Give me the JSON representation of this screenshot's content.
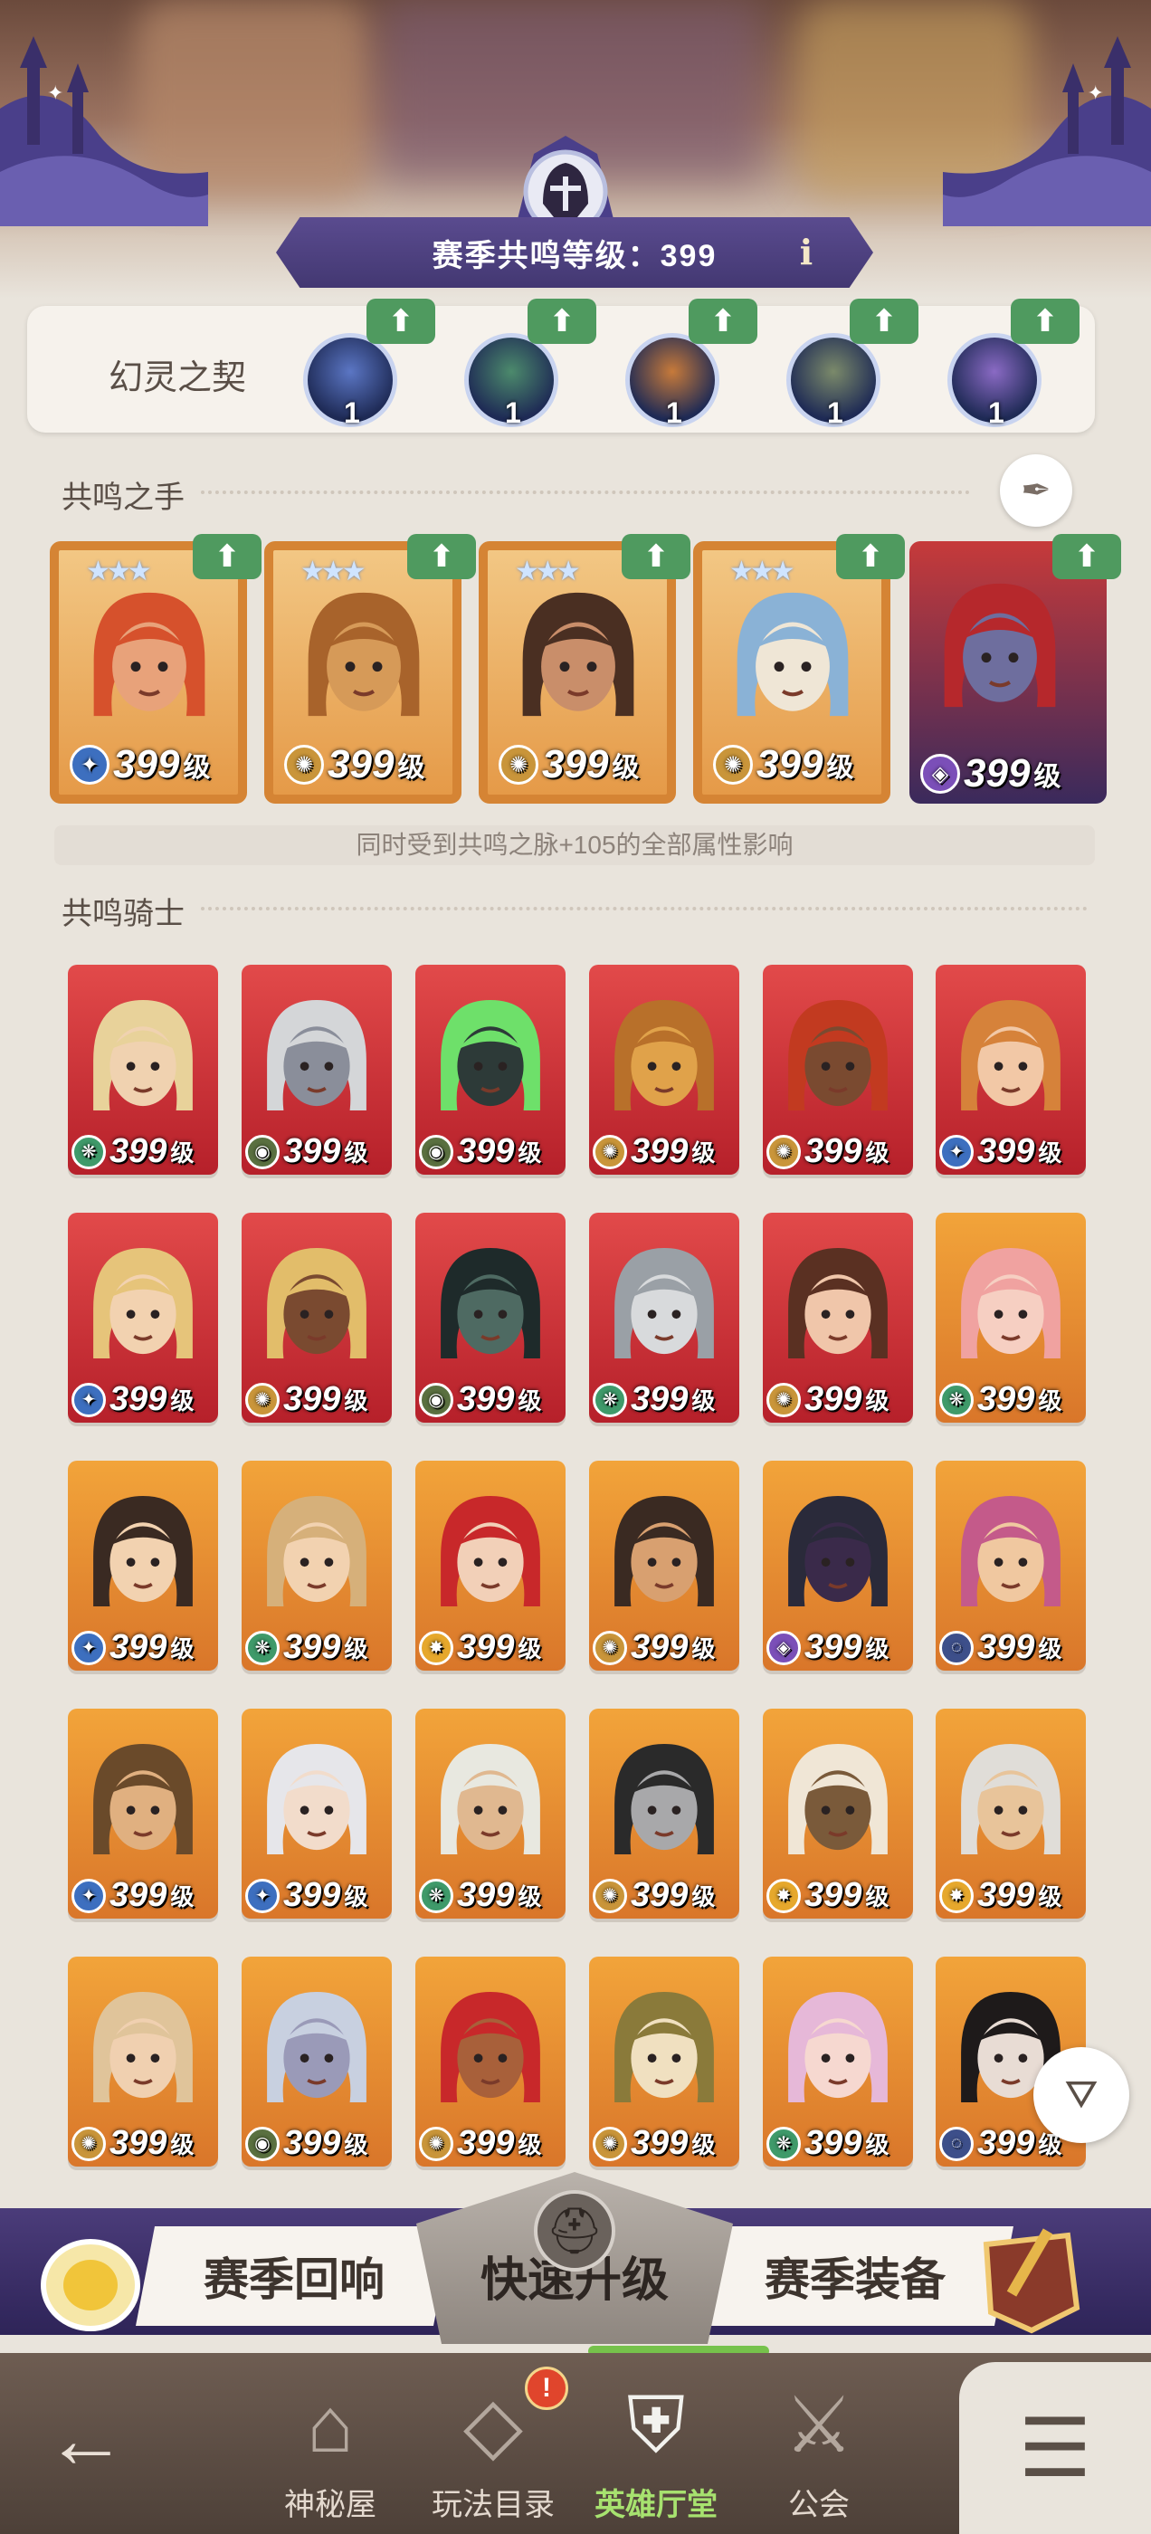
{
  "season": {
    "resonance_label": "赛季共鸣等级：399",
    "info_icon": "i"
  },
  "contract": {
    "title": "幻灵之契",
    "spirits": [
      {
        "level": "1",
        "element": "celestial",
        "color": "#5b76c4"
      },
      {
        "level": "1",
        "element": "forest",
        "color": "#4c8a6c"
      },
      {
        "level": "1",
        "element": "graveborn",
        "color": "#c77a3a"
      },
      {
        "level": "1",
        "element": "mauler",
        "color": "#7b8a6a"
      },
      {
        "level": "1",
        "element": "hypogean",
        "color": "#8a6ac4"
      }
    ],
    "up_icon": "⬆"
  },
  "hand": {
    "title": "共鸣之手",
    "quill_icon": "✒",
    "cards": [
      {
        "level": "399",
        "unit": "级",
        "element_icon": "✦",
        "element_color": "#3d6fbf",
        "stars": "★★★",
        "face": "#e8a27a",
        "hair": "#d6512c"
      },
      {
        "level": "399",
        "unit": "级",
        "element_icon": "✺",
        "element_color": "#c9953a",
        "stars": "★★★",
        "face": "#d69a58",
        "hair": "#a8632b"
      },
      {
        "level": "399",
        "unit": "级",
        "element_icon": "✺",
        "element_color": "#c9953a",
        "stars": "★★★",
        "face": "#c98e6a",
        "hair": "#4a2f22"
      },
      {
        "level": "399",
        "unit": "级",
        "element_icon": "✺",
        "element_color": "#c9953a",
        "stars": "★★★",
        "face": "#efe6d6",
        "hair": "#8ab2d6"
      },
      {
        "level": "399",
        "unit": "级",
        "element_icon": "◈",
        "element_color": "#7b4fb8",
        "stars": "",
        "face": "#6e6e9e",
        "hair": "#b6282c"
      }
    ],
    "note": "同时受到共鸣之脉+105的全部属性影响"
  },
  "knights": {
    "title": "共鸣骑士",
    "rows": [
      [
        {
          "level": "399",
          "unit": "级",
          "bg": "red",
          "element_icon": "❋",
          "element_color": "#3f9a6a",
          "face": "#f0d2b0",
          "hair": "#e8d29a"
        },
        {
          "level": "399",
          "unit": "级",
          "bg": "red",
          "element_icon": "◉",
          "element_color": "#5a7040",
          "face": "#8a8e9a",
          "hair": "#d4d6d8"
        },
        {
          "level": "399",
          "unit": "级",
          "bg": "red",
          "element_icon": "◉",
          "element_color": "#5a7040",
          "face": "#2d3a38",
          "hair": "#6ee06a"
        },
        {
          "level": "399",
          "unit": "级",
          "bg": "red",
          "element_icon": "✺",
          "element_color": "#c9953a",
          "face": "#e0a24a",
          "hair": "#b8702a"
        },
        {
          "level": "399",
          "unit": "级",
          "bg": "red",
          "element_icon": "✺",
          "element_color": "#c9953a",
          "face": "#7a4a30",
          "hair": "#c23a20"
        },
        {
          "level": "399",
          "unit": "级",
          "bg": "red",
          "element_icon": "✦",
          "element_color": "#3d6fbf",
          "face": "#f2c8a6",
          "hair": "#d6823a"
        }
      ],
      [
        {
          "level": "399",
          "unit": "级",
          "bg": "red",
          "element_icon": "✦",
          "element_color": "#3d6fbf",
          "face": "#f2d2b0",
          "hair": "#e6c47a"
        },
        {
          "level": "399",
          "unit": "级",
          "bg": "red",
          "element_icon": "✺",
          "element_color": "#c9953a",
          "face": "#7a4a30",
          "hair": "#e2bd6a"
        },
        {
          "level": "399",
          "unit": "级",
          "bg": "red",
          "element_icon": "◉",
          "element_color": "#5a7040",
          "face": "#4e6a62",
          "hair": "#1e2a2a"
        },
        {
          "level": "399",
          "unit": "级",
          "bg": "red",
          "element_icon": "❋",
          "element_color": "#3f9a6a",
          "face": "#d8dadc",
          "hair": "#9aa0a6"
        },
        {
          "level": "399",
          "unit": "级",
          "bg": "red",
          "element_icon": "✺",
          "element_color": "#c9953a",
          "face": "#f0c6aa",
          "hair": "#5a3022"
        },
        {
          "level": "399",
          "unit": "级",
          "bg": "orange",
          "element_icon": "❋",
          "element_color": "#3f9a6a",
          "face": "#f6cfc2",
          "hair": "#f0a2a0"
        }
      ],
      [
        {
          "level": "399",
          "unit": "级",
          "bg": "orange",
          "element_icon": "✦",
          "element_color": "#3d6fbf",
          "face": "#f2d2b0",
          "hair": "#3a2a22"
        },
        {
          "level": "399",
          "unit": "级",
          "bg": "orange",
          "element_icon": "❋",
          "element_color": "#3f9a6a",
          "face": "#f2d2b0",
          "hair": "#d6b07a"
        },
        {
          "level": "399",
          "unit": "级",
          "bg": "orange",
          "element_icon": "✸",
          "element_color": "#e6a82c",
          "face": "#f2d0b8",
          "hair": "#c8282a"
        },
        {
          "level": "399",
          "unit": "级",
          "bg": "orange",
          "element_icon": "✺",
          "element_color": "#c9953a",
          "face": "#d8a070",
          "hair": "#3a2a22"
        },
        {
          "level": "399",
          "unit": "级",
          "bg": "orange",
          "element_icon": "◈",
          "element_color": "#7b4fb8",
          "face": "#3a2a4a",
          "hair": "#2a2a3a"
        },
        {
          "level": "399",
          "unit": "级",
          "bg": "orange",
          "element_icon": "◌",
          "element_color": "#3d4f8a",
          "face": "#f0c8a0",
          "hair": "#c45a8a"
        }
      ],
      [
        {
          "level": "399",
          "unit": "级",
          "bg": "orange",
          "element_icon": "✦",
          "element_color": "#3d6fbf",
          "face": "#e0b080",
          "hair": "#6a4a2a"
        },
        {
          "level": "399",
          "unit": "级",
          "bg": "orange",
          "element_icon": "✦",
          "element_color": "#3d6fbf",
          "face": "#f2dccb",
          "hair": "#e6e6ea"
        },
        {
          "level": "399",
          "unit": "级",
          "bg": "orange",
          "element_icon": "❋",
          "element_color": "#3f9a6a",
          "face": "#e0b890",
          "hair": "#e8e8e0"
        },
        {
          "level": "399",
          "unit": "级",
          "bg": "orange",
          "element_icon": "✺",
          "element_color": "#c9953a",
          "face": "#a8a8aa",
          "hair": "#2a2a2a"
        },
        {
          "level": "399",
          "unit": "级",
          "bg": "orange",
          "element_icon": "✸",
          "element_color": "#e6a82c",
          "face": "#7a5a3a",
          "hair": "#f0e6d6"
        },
        {
          "level": "399",
          "unit": "级",
          "bg": "orange",
          "element_icon": "✸",
          "element_color": "#e6a82c",
          "face": "#e8c49a",
          "hair": "#e0ddd8"
        }
      ],
      [
        {
          "level": "399",
          "unit": "级",
          "bg": "orange",
          "element_icon": "✺",
          "element_color": "#c9953a",
          "face": "#f0d0b0",
          "hair": "#e0c49a"
        },
        {
          "level": "399",
          "unit": "级",
          "bg": "orange",
          "element_icon": "◉",
          "element_color": "#5a7040",
          "face": "#9a9ab8",
          "hair": "#c8d0e0"
        },
        {
          "level": "399",
          "unit": "级",
          "bg": "orange",
          "element_icon": "✺",
          "element_color": "#c9953a",
          "face": "#a8603a",
          "hair": "#c8282a"
        },
        {
          "level": "399",
          "unit": "级",
          "bg": "orange",
          "element_icon": "✺",
          "element_color": "#c9953a",
          "face": "#f0e0c0",
          "hair": "#8a7a3a"
        },
        {
          "level": "399",
          "unit": "级",
          "bg": "orange",
          "element_icon": "❋",
          "element_color": "#3f9a6a",
          "face": "#f6d8d0",
          "hair": "#e6b8d8"
        },
        {
          "level": "399",
          "unit": "级",
          "bg": "orange",
          "element_icon": "◌",
          "element_color": "#3d4f8a",
          "face": "#e8dcd4",
          "hair": "#1e1a1a"
        }
      ]
    ],
    "filter_icon": "⛛"
  },
  "actions": {
    "echo_label": "赛季回响",
    "quick_label": "快速升级",
    "equip_label": "赛季装备"
  },
  "nav": {
    "back_icon": "←",
    "items": [
      {
        "label": "神秘屋",
        "icon": "⌂"
      },
      {
        "label": "玩法目录",
        "icon": "◇"
      },
      {
        "label": "英雄厅堂",
        "icon": "⛨"
      },
      {
        "label": "公会",
        "icon": "⚔"
      }
    ],
    "alert": "!",
    "menu_icon": "☰"
  },
  "colors": {
    "banner": "#4b3f7e",
    "up_green": "#4f9a5f",
    "card_frame": "#d58434",
    "card_red": "#d23a3a",
    "card_orange": "#e8902f",
    "nav_active": "#a7e26f"
  }
}
